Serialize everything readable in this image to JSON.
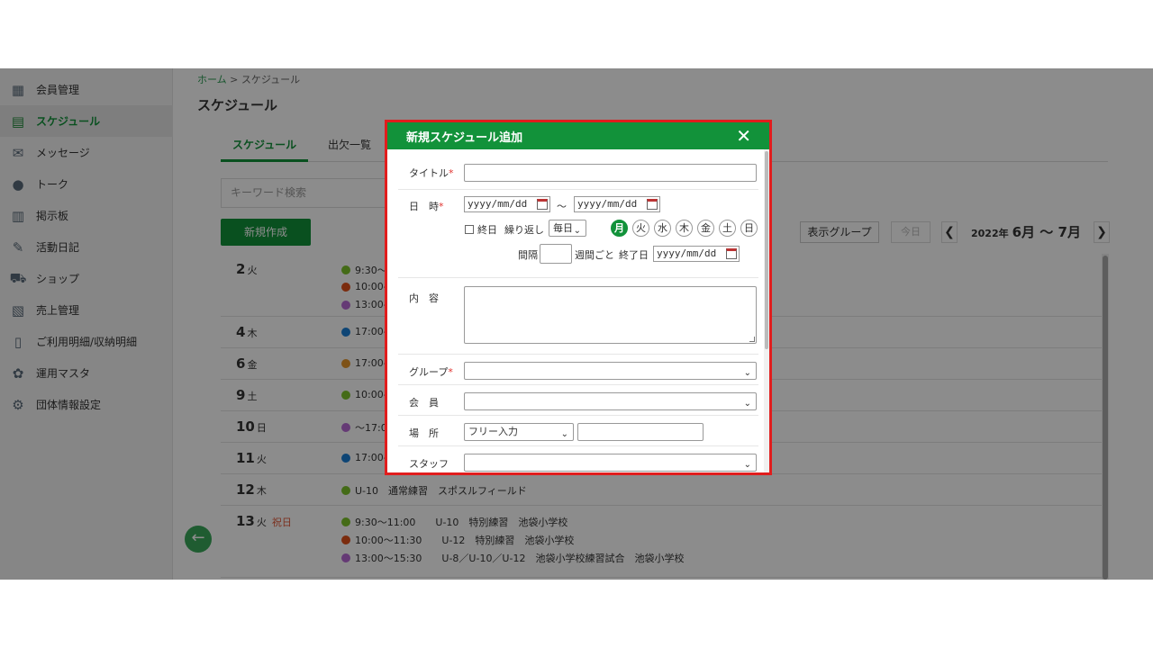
{
  "sidebar": {
    "items": [
      {
        "label": "会員管理",
        "icon": "members-icon",
        "glyph": "▦"
      },
      {
        "label": "スケジュール",
        "icon": "calendar-icon",
        "glyph": "▤",
        "active": true
      },
      {
        "label": "メッセージ",
        "icon": "mail-icon",
        "glyph": "✉"
      },
      {
        "label": "トーク",
        "icon": "chat-icon",
        "glyph": "●"
      },
      {
        "label": "掲示板",
        "icon": "board-icon",
        "glyph": "▥"
      },
      {
        "label": "活動日記",
        "icon": "diary-icon",
        "glyph": "✎"
      },
      {
        "label": "ショップ",
        "icon": "cart-icon",
        "glyph": "⛟"
      },
      {
        "label": "売上管理",
        "icon": "sales-icon",
        "glyph": "▧"
      },
      {
        "label": "ご利用明細/収納明細",
        "icon": "receipt-icon",
        "glyph": "▯"
      },
      {
        "label": "運用マスタ",
        "icon": "master-icon",
        "glyph": "✿"
      },
      {
        "label": "団体情報設定",
        "icon": "org-settings-icon",
        "glyph": "⚙"
      }
    ]
  },
  "breadcrumb": {
    "home": "ホーム",
    "sep": " > ",
    "current": "スケジュール"
  },
  "page": {
    "title": "スケジュール"
  },
  "tabs": [
    {
      "label": "スケジュール"
    },
    {
      "label": "出欠一覧"
    }
  ],
  "search": {
    "placeholder": "キーワード検索"
  },
  "toolbar": {
    "new_label": "新規作成",
    "group_label": "表示グループ",
    "today_label": "今日",
    "prev": "❮",
    "next": "❯",
    "year": "2022年",
    "months": "6月 〜 7月"
  },
  "days": [
    {
      "day": "2",
      "dow": "火",
      "holiday": "",
      "events": [
        {
          "color": "#7cc42a",
          "text": "9:30〜"
        },
        {
          "color": "#e0501a",
          "text": "10:00-"
        },
        {
          "color": "#b86ad6",
          "text": "13:00-"
        }
      ]
    },
    {
      "day": "4",
      "dow": "木",
      "holiday": "",
      "events": [
        {
          "color": "#1a7fd6",
          "text": "17:00-"
        }
      ]
    },
    {
      "day": "6",
      "dow": "金",
      "holiday": "",
      "events": [
        {
          "color": "#e6962a",
          "text": "17:00-"
        }
      ]
    },
    {
      "day": "9",
      "dow": "土",
      "holiday": "",
      "events": [
        {
          "color": "#7cc42a",
          "text": "10:00-"
        }
      ]
    },
    {
      "day": "10",
      "dow": "日",
      "holiday": "",
      "events": [
        {
          "color": "#b86ad6",
          "text": "〜17:0"
        }
      ]
    },
    {
      "day": "11",
      "dow": "火",
      "holiday": "",
      "events": [
        {
          "color": "#1a7fd6",
          "text": "17:00-"
        }
      ]
    },
    {
      "day": "12",
      "dow": "木",
      "holiday": "",
      "events": [
        {
          "color": "#7cc42a",
          "text": "U-10　通常練習　スポスルフィールド"
        }
      ]
    },
    {
      "day": "13",
      "dow": "火",
      "holiday": "祝日",
      "events": [
        {
          "color": "#7cc42a",
          "text": "9:30〜11:00　　U-10　特別練習　池袋小学校"
        },
        {
          "color": "#e0501a",
          "text": "10:00〜11:30　　U-12　特別練習　池袋小学校"
        },
        {
          "color": "#b86ad6",
          "text": "13:00〜15:30　　U-8／U-10／U-12　池袋小学校練習試合　池袋小学校"
        }
      ]
    }
  ],
  "modal": {
    "title": "新規スケジュール追加",
    "close": "✕",
    "fields": {
      "title_label": "タイトル",
      "required_mark": "*",
      "datetime_label": "日　時",
      "date_placeholder": "yyyy/mm/dd",
      "tilde": "〜",
      "allday_label": "終日",
      "repeat_label": "繰り返し",
      "repeat_value": "毎日",
      "weekdays": [
        {
          "label": "月",
          "on": true
        },
        {
          "label": "火",
          "on": false
        },
        {
          "label": "水",
          "on": false
        },
        {
          "label": "木",
          "on": false
        },
        {
          "label": "金",
          "on": false
        },
        {
          "label": "土",
          "on": false
        },
        {
          "label": "日",
          "on": false
        }
      ],
      "interval_label": "間隔",
      "interval_value": "",
      "weekly_label": "週間ごと",
      "end_label": "終了日",
      "content_label": "内　容",
      "group_label": "グループ",
      "member_label": "会　員",
      "place_label": "場　所",
      "place_mode": "フリー入力",
      "staff_label": "スタッフ"
    }
  }
}
